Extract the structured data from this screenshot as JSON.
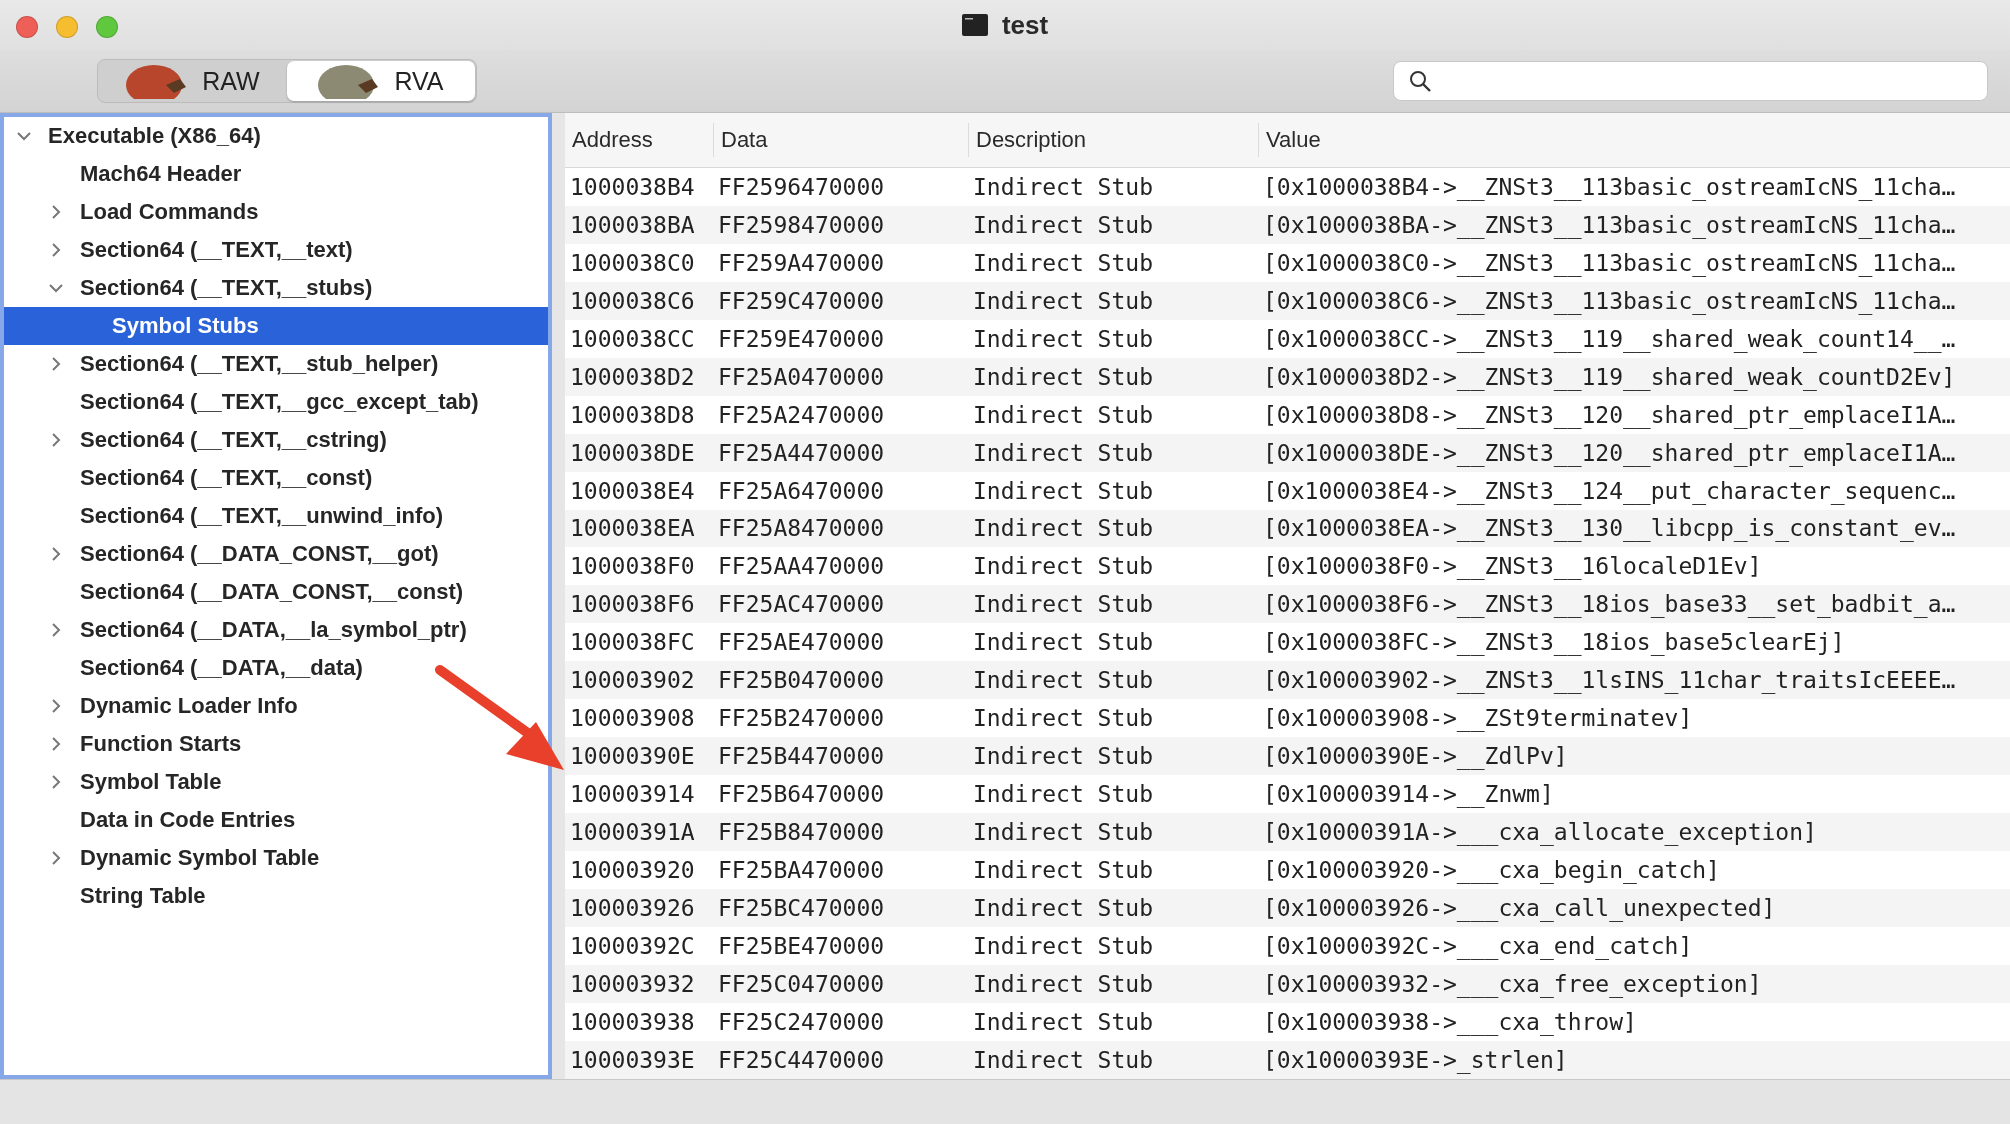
{
  "window": {
    "title": "test"
  },
  "mode_tabs": [
    {
      "label": "RAW",
      "selected": false
    },
    {
      "label": "RVA",
      "selected": true
    }
  ],
  "tree": [
    {
      "label": "Executable  (X86_64)",
      "kind": "group",
      "expanded": true,
      "selected": false,
      "children": [
        {
          "label": "Mach64 Header",
          "kind": "leaf",
          "selected": false
        },
        {
          "label": "Load Commands",
          "kind": "group",
          "expanded": false,
          "selected": false
        },
        {
          "label": "Section64 (__TEXT,__text)",
          "kind": "group",
          "expanded": false,
          "selected": false
        },
        {
          "label": "Section64 (__TEXT,__stubs)",
          "kind": "group",
          "expanded": true,
          "selected": false,
          "children": [
            {
              "label": "Symbol Stubs",
              "kind": "leaf",
              "selected": true
            }
          ]
        },
        {
          "label": "Section64 (__TEXT,__stub_helper)",
          "kind": "group",
          "expanded": false,
          "selected": false
        },
        {
          "label": "Section64 (__TEXT,__gcc_except_tab)",
          "kind": "leaf",
          "selected": false
        },
        {
          "label": "Section64 (__TEXT,__cstring)",
          "kind": "group",
          "expanded": false,
          "selected": false
        },
        {
          "label": "Section64 (__TEXT,__const)",
          "kind": "leaf",
          "selected": false
        },
        {
          "label": "Section64 (__TEXT,__unwind_info)",
          "kind": "leaf",
          "selected": false
        },
        {
          "label": "Section64 (__DATA_CONST,__got)",
          "kind": "group",
          "expanded": false,
          "selected": false
        },
        {
          "label": "Section64 (__DATA_CONST,__const)",
          "kind": "leaf",
          "selected": false
        },
        {
          "label": "Section64 (__DATA,__la_symbol_ptr)",
          "kind": "group",
          "expanded": false,
          "selected": false
        },
        {
          "label": "Section64 (__DATA,__data)",
          "kind": "leaf",
          "selected": false
        },
        {
          "label": "Dynamic Loader Info",
          "kind": "group",
          "expanded": false,
          "selected": false
        },
        {
          "label": "Function Starts",
          "kind": "group",
          "expanded": false,
          "selected": false
        },
        {
          "label": "Symbol Table",
          "kind": "group",
          "expanded": false,
          "selected": false
        },
        {
          "label": "Data in Code Entries",
          "kind": "leaf",
          "selected": false
        },
        {
          "label": "Dynamic Symbol Table",
          "kind": "group",
          "expanded": false,
          "selected": false
        },
        {
          "label": "String Table",
          "kind": "leaf",
          "selected": false
        }
      ]
    }
  ],
  "table": {
    "columns": [
      "Address",
      "Data",
      "Description",
      "Value"
    ],
    "rows": [
      [
        "1000038B4",
        "FF2596470000",
        "Indirect Stub",
        "[0x1000038B4->__ZNSt3__113basic_ostreamIcNS_11cha…"
      ],
      [
        "1000038BA",
        "FF2598470000",
        "Indirect Stub",
        "[0x1000038BA->__ZNSt3__113basic_ostreamIcNS_11cha…"
      ],
      [
        "1000038C0",
        "FF259A470000",
        "Indirect Stub",
        "[0x1000038C0->__ZNSt3__113basic_ostreamIcNS_11cha…"
      ],
      [
        "1000038C6",
        "FF259C470000",
        "Indirect Stub",
        "[0x1000038C6->__ZNSt3__113basic_ostreamIcNS_11cha…"
      ],
      [
        "1000038CC",
        "FF259E470000",
        "Indirect Stub",
        "[0x1000038CC->__ZNSt3__119__shared_weak_count14__…"
      ],
      [
        "1000038D2",
        "FF25A0470000",
        "Indirect Stub",
        "[0x1000038D2->__ZNSt3__119__shared_weak_countD2Ev]"
      ],
      [
        "1000038D8",
        "FF25A2470000",
        "Indirect Stub",
        "[0x1000038D8->__ZNSt3__120__shared_ptr_emplaceI1A…"
      ],
      [
        "1000038DE",
        "FF25A4470000",
        "Indirect Stub",
        "[0x1000038DE->__ZNSt3__120__shared_ptr_emplaceI1A…"
      ],
      [
        "1000038E4",
        "FF25A6470000",
        "Indirect Stub",
        "[0x1000038E4->__ZNSt3__124__put_character_sequenc…"
      ],
      [
        "1000038EA",
        "FF25A8470000",
        "Indirect Stub",
        "[0x1000038EA->__ZNSt3__130__libcpp_is_constant_ev…"
      ],
      [
        "1000038F0",
        "FF25AA470000",
        "Indirect Stub",
        "[0x1000038F0->__ZNSt3__16localeD1Ev]"
      ],
      [
        "1000038F6",
        "FF25AC470000",
        "Indirect Stub",
        "[0x1000038F6->__ZNSt3__18ios_base33__set_badbit_a…"
      ],
      [
        "1000038FC",
        "FF25AE470000",
        "Indirect Stub",
        "[0x1000038FC->__ZNSt3__18ios_base5clearEj]"
      ],
      [
        "100003902",
        "FF25B0470000",
        "Indirect Stub",
        "[0x100003902->__ZNSt3__1lsINS_11char_traitsIcEEEE…"
      ],
      [
        "100003908",
        "FF25B2470000",
        "Indirect Stub",
        "[0x100003908->__ZSt9terminatev]"
      ],
      [
        "10000390E",
        "FF25B4470000",
        "Indirect Stub",
        "[0x10000390E->__ZdlPv]"
      ],
      [
        "100003914",
        "FF25B6470000",
        "Indirect Stub",
        "[0x100003914->__Znwm]"
      ],
      [
        "10000391A",
        "FF25B8470000",
        "Indirect Stub",
        "[0x10000391A->___cxa_allocate_exception]"
      ],
      [
        "100003920",
        "FF25BA470000",
        "Indirect Stub",
        "[0x100003920->___cxa_begin_catch]"
      ],
      [
        "100003926",
        "FF25BC470000",
        "Indirect Stub",
        "[0x100003926->___cxa_call_unexpected]"
      ],
      [
        "10000392C",
        "FF25BE470000",
        "Indirect Stub",
        "[0x10000392C->___cxa_end_catch]"
      ],
      [
        "100003932",
        "FF25C0470000",
        "Indirect Stub",
        "[0x100003932->___cxa_free_exception]"
      ],
      [
        "100003938",
        "FF25C2470000",
        "Indirect Stub",
        "[0x100003938->___cxa_throw]"
      ],
      [
        "10000393E",
        "FF25C4470000",
        "Indirect Stub",
        "[0x10000393E->_strlen]"
      ]
    ]
  }
}
